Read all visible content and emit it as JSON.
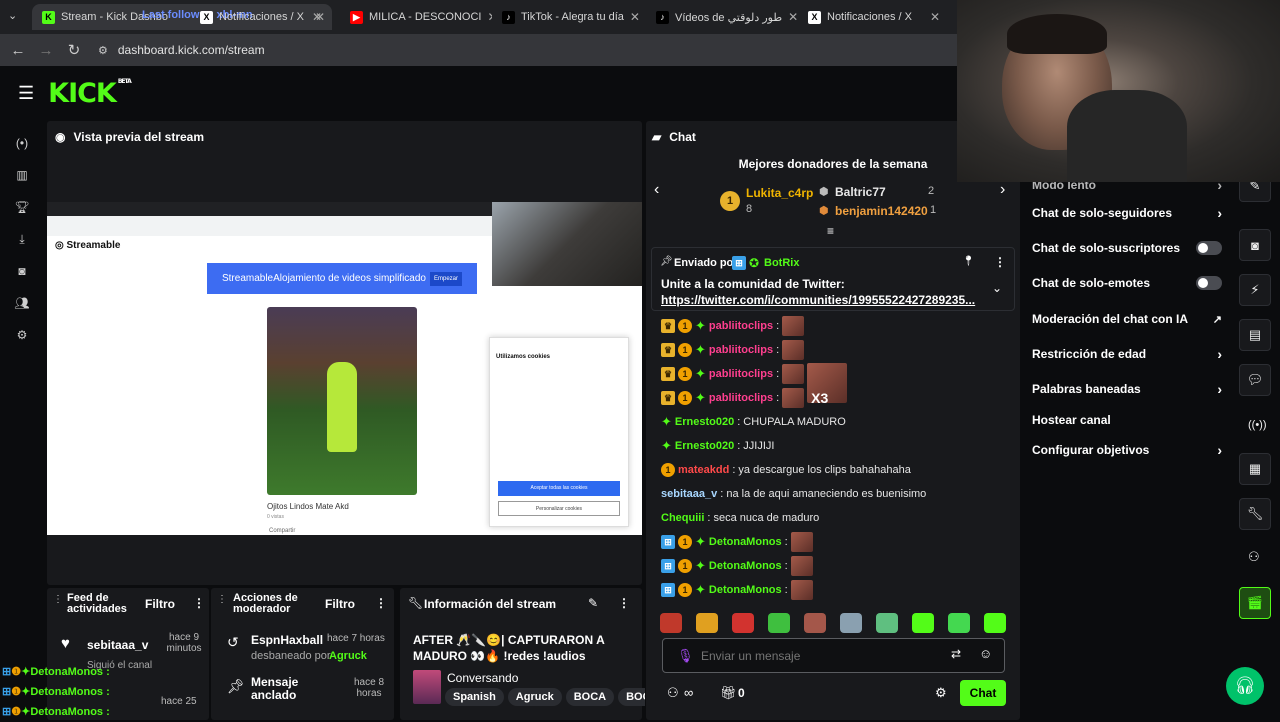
{
  "browser": {
    "tabs": [
      {
        "label": "Stream - Kick Dashbo",
        "favicon": "kick-icon",
        "active": true
      },
      {
        "label": "Notificaciones / X",
        "favicon": "x-icon"
      },
      {
        "label": "MILICA - DESCONOCI",
        "favicon": "youtube-icon"
      },
      {
        "label": "TikTok - Alegra tu día",
        "favicon": "tiktok-icon"
      },
      {
        "label": "Vídeos de ‏طور دلوقتي",
        "favicon": "tiktok-icon"
      },
      {
        "label": "Notificaciones / X",
        "favicon": "x-icon"
      }
    ],
    "url": "dashboard.kick.com/stream",
    "tab_overlay": "Last follower: xbl-mn"
  },
  "kick": {
    "logo": "KICK",
    "beta": "BETA"
  },
  "preview": {
    "title": "Vista previa del stream",
    "inner": {
      "site": "Streamable",
      "banner_text": "StreamableAlojamiento de videos simplificado",
      "banner_button": "Empezar",
      "video_title": "Ojitos Lindos Mate Akd",
      "video_views": "0 vistas",
      "share": "Compartir",
      "cookie_title": "Utilizamos cookies",
      "cookie_accept": "Aceptar todas las cookies",
      "cookie_customize": "Personalizar cookies"
    }
  },
  "feed": {
    "title": "Feed de actividades",
    "filter": "Filtro",
    "items": [
      {
        "user": "sebitaaa_v",
        "time": "hace 9 minutos",
        "text": "Siguió el canal"
      },
      {
        "time": "hace 25"
      }
    ]
  },
  "mod": {
    "title": "Acciones de moderador",
    "filter": "Filtro",
    "items": [
      {
        "user": "EspnHaxball",
        "time": "hace 7 horas",
        "text": "desbaneado por",
        "by": "Agruck"
      },
      {
        "user": "Mensaje anclado",
        "time": "hace 8 horas"
      }
    ]
  },
  "info": {
    "title": "Información del stream",
    "stream_title": "AFTER 🥂🔪😊| CAPTURARON A MADURO 👀🔥 !redes !audios",
    "category": "Conversando",
    "tags": [
      "Spanish",
      "Agruck",
      "BOCA",
      "BOC"
    ]
  },
  "chat": {
    "title": "Chat",
    "donors_title": "Mejores donadores de la semana",
    "donors": [
      {
        "rank": "1",
        "name": "Lukita_c4rp",
        "amount": "8"
      },
      {
        "name": "Baltric77",
        "amount": "2"
      },
      {
        "name": "benjamin142420",
        "amount": "1"
      }
    ],
    "pinned": {
      "label": "Enviado por",
      "author": "BotRix",
      "text": "Unite a la comunidad de Twitter:",
      "link": "https://twitter.com/i/communities/19955522427289235..."
    },
    "messages": [
      {
        "user": "pabliitoclips",
        "text": "",
        "color": "pink"
      },
      {
        "user": "pabliitoclips",
        "text": "",
        "color": "pink"
      },
      {
        "user": "pabliitoclips",
        "text": "",
        "color": "pink"
      },
      {
        "user": "pabliitoclips",
        "text": "",
        "color": "pink",
        "multiplier": "X3"
      },
      {
        "user": "Ernesto020",
        "text": "CHUPALA MADURO",
        "color": "green"
      },
      {
        "user": "Ernesto020",
        "text": "JJIJIJI",
        "color": "green"
      },
      {
        "user": "mateakdd",
        "text": "ya descargue los clips bahahahaha",
        "color": "orange"
      },
      {
        "user": "sebitaaa_v",
        "text": "na la de aqui amaneciendo es buenisimo",
        "color": "teal"
      },
      {
        "user": "Chequiii",
        "text": "seca nuca de maduro",
        "color": "green"
      },
      {
        "user": "DetonaMonos",
        "text": "",
        "color": "green"
      },
      {
        "user": "DetonaMonos",
        "text": "",
        "color": "green"
      },
      {
        "user": "DetonaMonos",
        "text": "",
        "color": "green"
      }
    ],
    "input_placeholder": "Enviar un mensaje",
    "points": "0",
    "send_button": "Chat"
  },
  "settings": {
    "items": [
      {
        "label": "Modo lento",
        "type": "chevron"
      },
      {
        "label": "Chat de solo-seguidores",
        "type": "chevron"
      },
      {
        "label": "Chat de solo-suscriptores",
        "type": "toggle"
      },
      {
        "label": "Chat de solo-emotes",
        "type": "toggle"
      },
      {
        "label": "Moderación del chat con IA",
        "type": "external"
      },
      {
        "label": "Restricción de edad",
        "type": "chevron"
      },
      {
        "label": "Palabras baneadas",
        "type": "chevron"
      },
      {
        "label": "Hostear canal",
        "type": "none"
      },
      {
        "label": "Configurar objetivos",
        "type": "chevron"
      }
    ]
  },
  "overlay": {
    "lines": [
      "DetonaMonos :",
      "DetonaMonos :",
      "DetonaMonos :"
    ]
  },
  "colors": {
    "accent": "#53fc18",
    "bg": "#0b0c0e",
    "panel": "#18191c"
  }
}
